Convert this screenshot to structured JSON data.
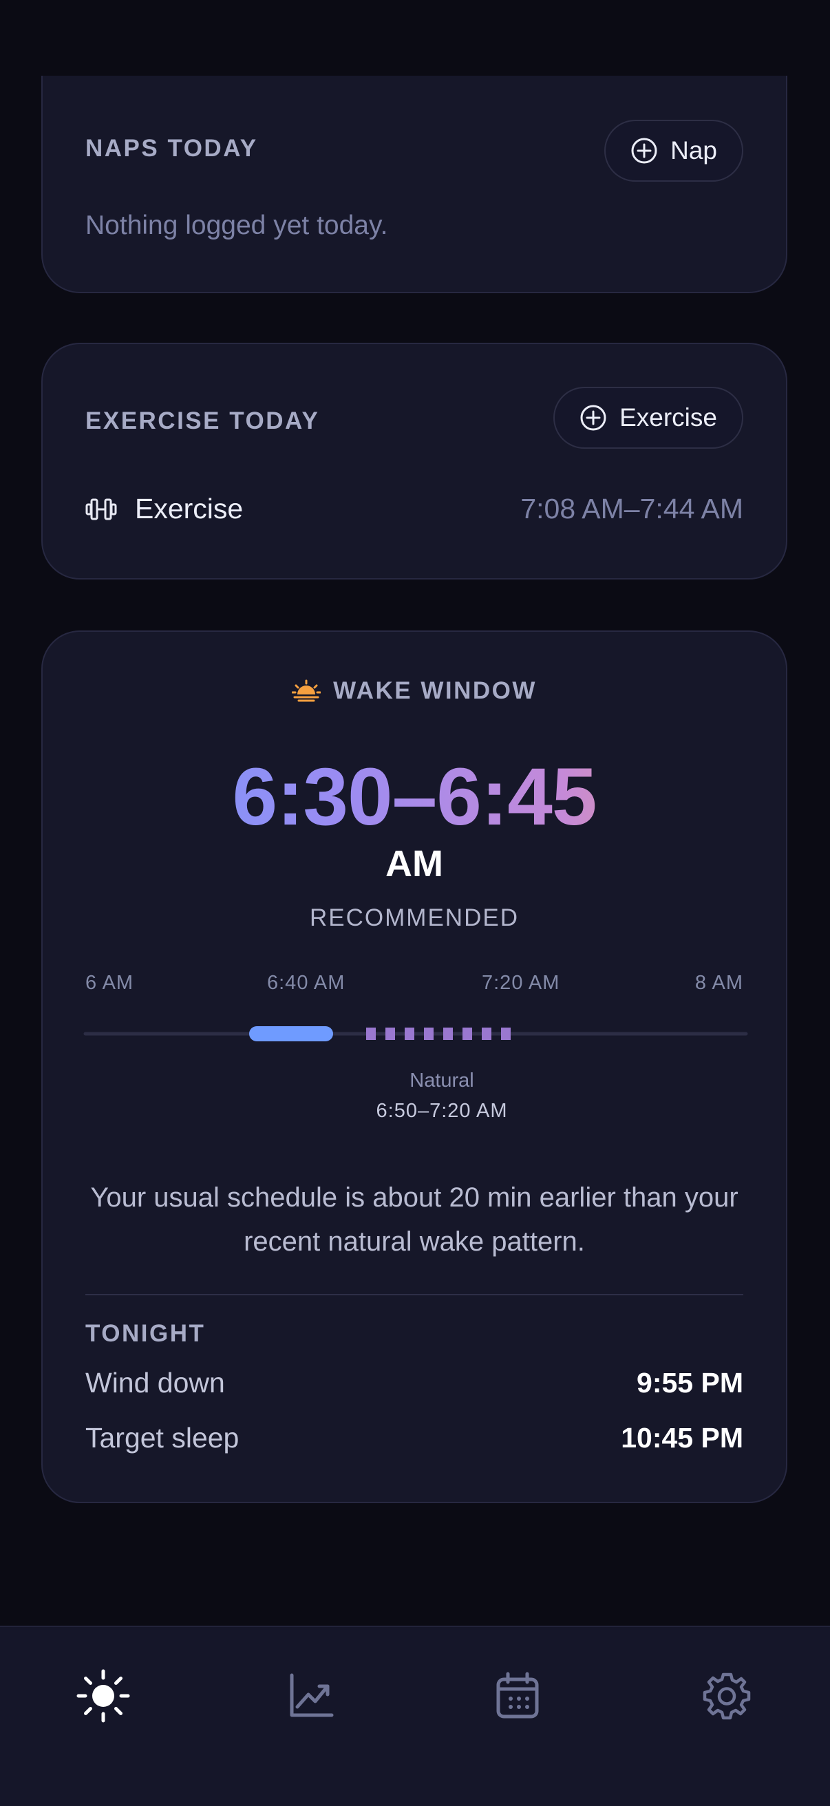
{
  "naps": {
    "title": "NAPS TODAY",
    "button_label": "Nap",
    "empty_text": "Nothing logged yet today."
  },
  "exercise": {
    "title": "EXERCISE TODAY",
    "button_label": "Exercise",
    "entries": [
      {
        "name": "Exercise",
        "time": "7:08 AM–7:44 AM",
        "icon": "dumbbell-icon"
      }
    ]
  },
  "wake": {
    "title": "WAKE WINDOW",
    "icon": "sunrise-icon",
    "time_range": "6:30–6:45",
    "period": "AM",
    "status": "RECOMMENDED",
    "timeline": {
      "ticks": [
        "6 AM",
        "6:40 AM",
        "7:20 AM",
        "8 AM"
      ],
      "recommended_range": [
        "6:30 AM",
        "6:45 AM"
      ],
      "natural_range": [
        "6:50 AM",
        "7:20 AM"
      ],
      "natural_label": "Natural",
      "natural_time": "6:50–7:20 AM"
    },
    "message": "Your usual schedule is about 20 min earlier than your recent natural wake pattern."
  },
  "tonight": {
    "title": "TONIGHT",
    "rows": [
      {
        "label": "Wind down",
        "value": "9:55 PM"
      },
      {
        "label": "Target sleep",
        "value": "10:45 PM"
      }
    ]
  },
  "nav": {
    "items": [
      {
        "icon": "sun-icon",
        "active": true
      },
      {
        "icon": "chart-icon",
        "active": false
      },
      {
        "icon": "calendar-icon",
        "active": false
      },
      {
        "icon": "gear-icon",
        "active": false
      }
    ]
  },
  "colors": {
    "background": "#0b0b14",
    "card": "#161729",
    "recommended": "#6f9bff",
    "natural": "#9a78d0",
    "sunrise": "#f6a040"
  }
}
